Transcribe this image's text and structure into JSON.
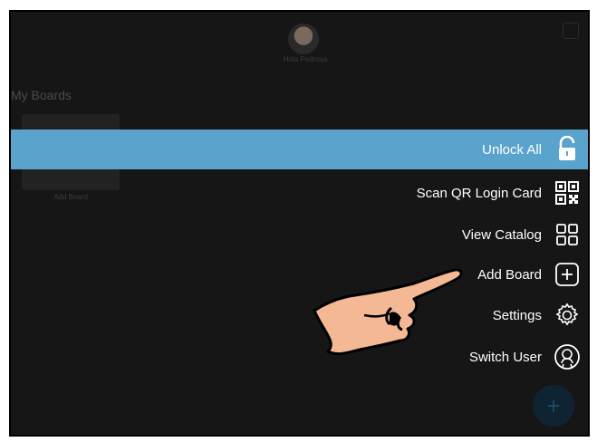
{
  "user": {
    "name": "Hola Pedrosa"
  },
  "boards": {
    "section_title": "My Boards",
    "add_board_label": "Add Board"
  },
  "menu": {
    "items": [
      {
        "label": "Unlock All",
        "icon": "unlock-icon"
      },
      {
        "label": "Scan QR Login Card",
        "icon": "qr-code-icon"
      },
      {
        "label": "View Catalog",
        "icon": "grid-icon"
      },
      {
        "label": "Add Board",
        "icon": "plus-square-icon"
      },
      {
        "label": "Settings",
        "icon": "gear-icon"
      },
      {
        "label": "Switch User",
        "icon": "user-circle-icon"
      }
    ]
  },
  "fab": {
    "label": "+"
  },
  "colors": {
    "highlight": "#5aa3cc",
    "background": "#161616",
    "hand_skin": "#f4b894"
  }
}
